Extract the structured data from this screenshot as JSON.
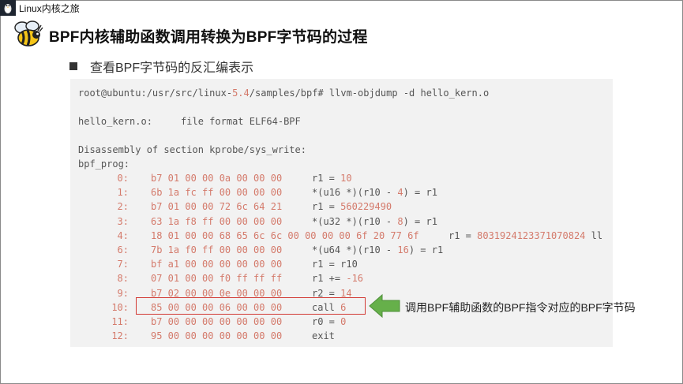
{
  "topbar": {
    "brand": "Linux内核之旅"
  },
  "slide": {
    "title": "BPF内核辅助函数调用转换为BPF字节码的过程",
    "bullet": "查看BPF字节码的反汇编表示"
  },
  "code": {
    "command": {
      "prefix": "root@ubuntu:/usr/src/linux-",
      "ver": "5.4",
      "suffix": "/samples/bpf# llvm-objdump -d hello_kern.o"
    },
    "file_line": "hello_kern.o:     file format ELF64-BPF",
    "section_line": "Disassembly of section kprobe/sys_write:",
    "label": "bpf_prog:",
    "rows": [
      {
        "addr": "0:",
        "bytes": "b7 01 00 00 0a 00 00 00",
        "asm": "r1 = 10"
      },
      {
        "addr": "1:",
        "bytes": "6b 1a fc ff 00 00 00 00",
        "asm": "*(u16 *)(r10 - 4) = r1"
      },
      {
        "addr": "2:",
        "bytes": "b7 01 00 00 72 6c 64 21",
        "asm": "r1 = 560229490"
      },
      {
        "addr": "3:",
        "bytes": "63 1a f8 ff 00 00 00 00",
        "asm": "*(u32 *)(r10 - 8) = r1"
      },
      {
        "addr": "4:",
        "bytes": "18 01 00 00 68 65 6c 6c 00 00 00 00 6f 20 77 6f",
        "asm": "r1 = 8031924123371070824 ll"
      },
      {
        "addr": "6:",
        "bytes": "7b 1a f0 ff 00 00 00 00",
        "asm": "*(u64 *)(r10 - 16) = r1"
      },
      {
        "addr": "7:",
        "bytes": "bf a1 00 00 00 00 00 00",
        "asm": "r1 = r10"
      },
      {
        "addr": "8:",
        "bytes": "07 01 00 00 f0 ff ff ff",
        "asm": "r1 += -16"
      },
      {
        "addr": "9:",
        "bytes": "b7 02 00 00 0e 00 00 00",
        "asm": "r2 = 14"
      },
      {
        "addr": "10:",
        "bytes": "85 00 00 00 06 00 00 00",
        "asm": "call 6"
      },
      {
        "addr": "11:",
        "bytes": "b7 00 00 00 00 00 00 00",
        "asm": "r0 = 0"
      },
      {
        "addr": "12:",
        "bytes": "95 00 00 00 00 00 00 00",
        "asm": "exit"
      }
    ]
  },
  "annotation": "调用BPF辅助函数的BPF指令对应的BPF字节码",
  "colors": {
    "number": "#d47a6b",
    "highlight_box": "#d23a34",
    "arrow": "#66b04a",
    "code_bg": "#f2f2f2"
  }
}
